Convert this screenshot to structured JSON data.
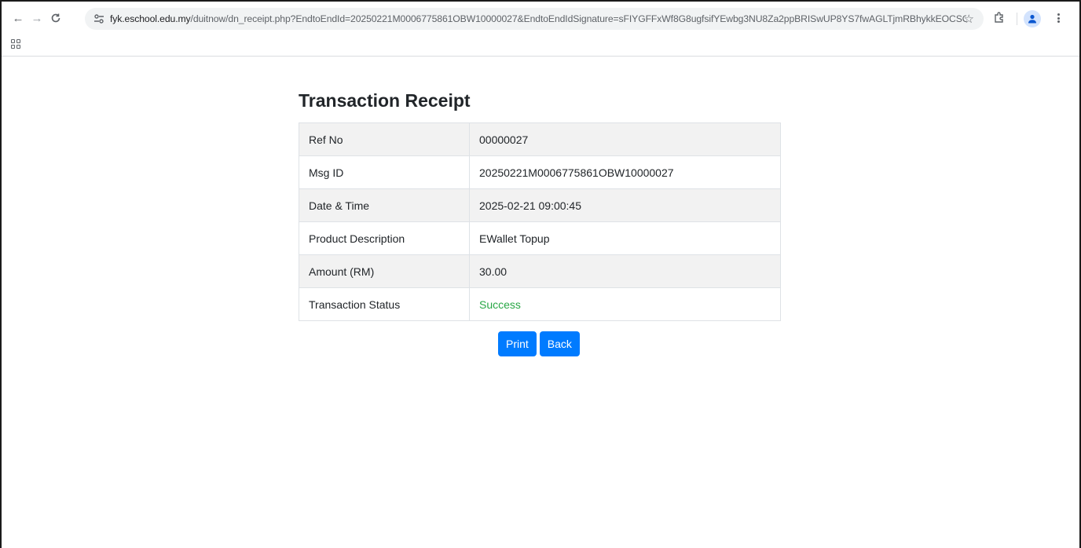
{
  "browser": {
    "url_host": "fyk.eschool.edu.my",
    "url_rest": "/duitnow/dn_receipt.php?EndtoEndId=20250221M0006775861OBW10000027&EndtoEndIdSignature=sFIYGFFxWf8G8ugfsifYEwbg3NU8Za2ppBRISwUP8YS7fwAGLTjmRBhykkEOCSO%2...",
    "icons": [
      "back-arrow-icon",
      "forward-arrow-icon",
      "reload-icon",
      "site-info-icon",
      "star-icon",
      "extensions-icon",
      "profile-icon",
      "menu-icon",
      "apps-icon"
    ]
  },
  "page": {
    "title": "Transaction Receipt",
    "rows": [
      {
        "label": "Ref No",
        "value": "00000027"
      },
      {
        "label": "Msg ID",
        "value": "20250221M0006775861OBW10000027"
      },
      {
        "label": "Date & Time",
        "value": "2025-02-21 09:00:45"
      },
      {
        "label": "Product Description",
        "value": "EWallet Topup"
      },
      {
        "label": "Amount (RM)",
        "value": "30.00"
      },
      {
        "label": "Transaction Status",
        "value": "Success"
      }
    ],
    "buttons": {
      "print_label": "Print",
      "back_label": "Back"
    }
  },
  "colors": {
    "button_primary": "#007bff",
    "status_success": "#28a745",
    "striped_row": "#f2f2f2"
  }
}
